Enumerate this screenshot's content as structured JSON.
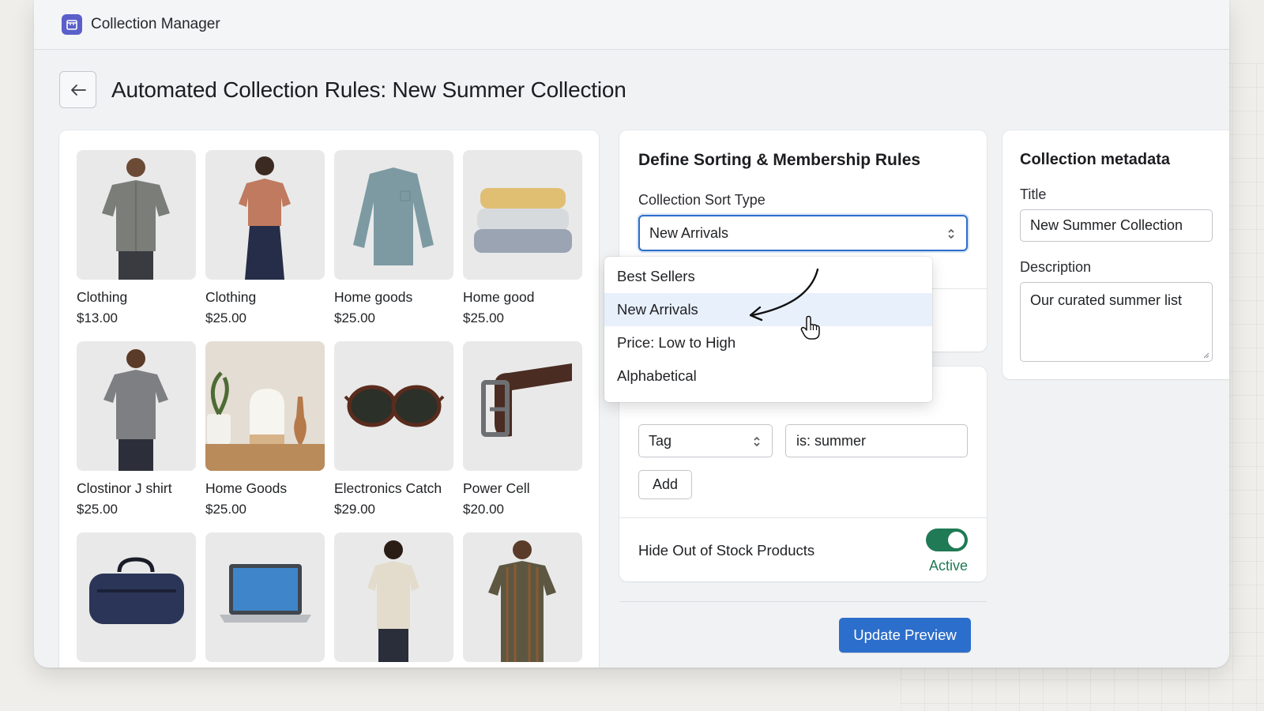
{
  "app": {
    "title": "Collection Manager",
    "icon": "store-icon",
    "accent": "#5a5fc9"
  },
  "page": {
    "title": "Automated Collection Rules: New Summer Collection",
    "back_icon": "arrow-left-icon"
  },
  "products": [
    {
      "name": "Clothing",
      "price": "$13.00",
      "image": "man-checked-shirt"
    },
    {
      "name": "Clothing",
      "price": "$25.00",
      "image": "woman-terracotta-tee"
    },
    {
      "name": "Home goods",
      "price": "$25.00",
      "image": "blue-longsleeve-tee"
    },
    {
      "name": "Home good",
      "price": "$25.00",
      "image": "folded-towels"
    },
    {
      "name": "Clostinor J shirt",
      "price": "$25.00",
      "image": "man-grey-tee"
    },
    {
      "name": "Home Goods",
      "price": "$25.00",
      "image": "diffuser-and-vases"
    },
    {
      "name": "Electronics Catch",
      "price": "$29.00",
      "image": "sunglasses"
    },
    {
      "name": "Power Cell",
      "price": "$20.00",
      "image": "leather-belt"
    },
    {
      "name": "",
      "price": "",
      "image": "navy-duffel-bag"
    },
    {
      "name": "",
      "price": "",
      "image": "laptop"
    },
    {
      "name": "",
      "price": "",
      "image": "man-beige-tee"
    },
    {
      "name": "",
      "price": "",
      "image": "man-striped-shirt"
    }
  ],
  "rules": {
    "title": "Define Sorting & Membership Rules",
    "sort_label": "Collection Sort Type",
    "sort_value": "New Arrivals",
    "sort_options": [
      "Best Sellers",
      "New Arrivals",
      "Price: Low to High",
      "Alphabetical"
    ],
    "selected_option": "New Arrivals"
  },
  "conditions": {
    "field": "Tag",
    "value": "is: summer",
    "add_label": "Add",
    "toggle_label": "Hide Out of Stock Products",
    "toggle_status": "Active",
    "toggle_on": true,
    "toggle_color": "#1f7a55"
  },
  "actions": {
    "update_label": "Update Preview",
    "primary_color": "#2c6ecb"
  },
  "metadata": {
    "title": "Collection metadata",
    "title_label": "Title",
    "title_value": "New Summer Collection",
    "description_label": "Description",
    "description_value": "Our curated summer list"
  }
}
